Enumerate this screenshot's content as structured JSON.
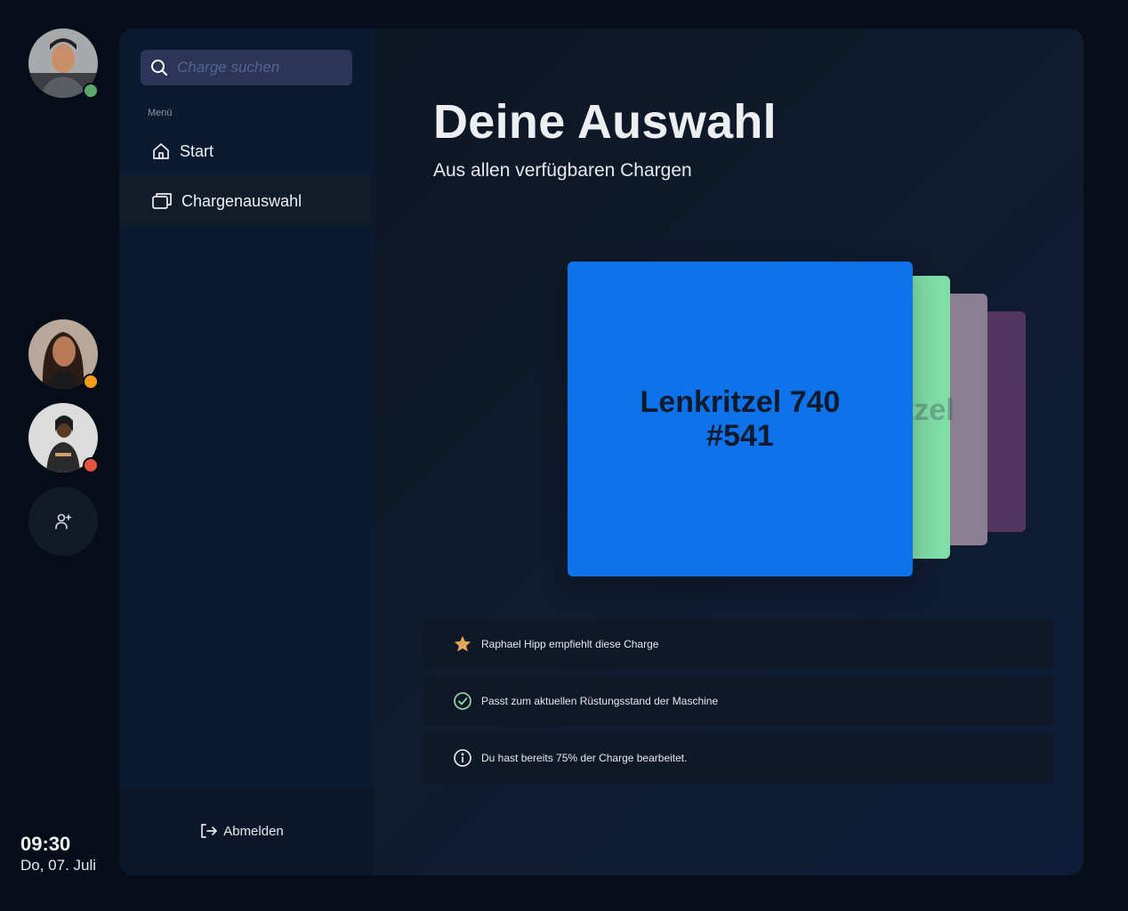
{
  "users": [
    {
      "name": "user-1",
      "status": "online",
      "status_color": "#5aa96b"
    },
    {
      "name": "user-2",
      "status": "away",
      "status_color": "#f59c1a"
    },
    {
      "name": "user-3",
      "status": "busy",
      "status_color": "#e2543f"
    }
  ],
  "add_user_icon": "add-user-icon",
  "clock": {
    "time": "09:30",
    "date": "Do, 07. Juli"
  },
  "search": {
    "placeholder": "Charge suchen",
    "value": ""
  },
  "sidebar": {
    "menu_label": "Menü",
    "items": [
      {
        "label": "Start",
        "icon": "home-icon",
        "active": false
      },
      {
        "label": "Chargenauswahl",
        "icon": "batches-icon",
        "active": true
      }
    ],
    "logout_label": "Abmelden"
  },
  "main": {
    "title": "Deine Auswahl",
    "subtitle": "Aus allen verfügbaren Chargen",
    "cards": {
      "front": {
        "name": "Lenkritzel 740",
        "number": "#541",
        "color": "#0e72ea"
      },
      "back_text": "tzel",
      "back_colors": [
        "#7fdda6",
        "#8b7f94",
        "#52365f"
      ]
    },
    "info": [
      {
        "icon": "star-icon",
        "text": "Raphael Hipp empfiehlt diese Charge"
      },
      {
        "icon": "check-circle-icon",
        "text": "Passt zum aktuellen Rüstungsstand der Maschine"
      },
      {
        "icon": "info-icon",
        "text": "Du hast bereits 75% der Charge bearbeitet."
      }
    ]
  }
}
